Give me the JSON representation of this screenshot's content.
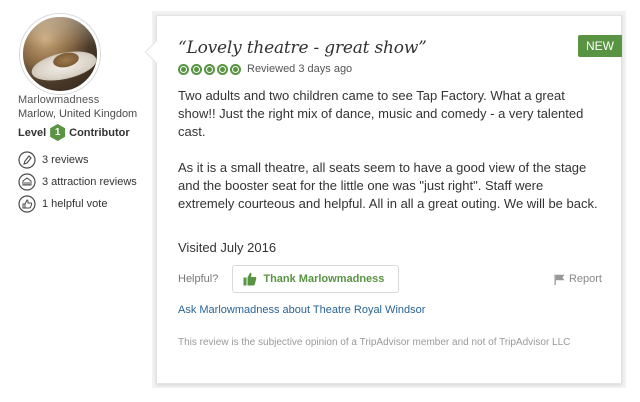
{
  "member": {
    "username": "Marlowmadness",
    "location": "Marlow, United Kingdom",
    "level_label": "Level",
    "level_number": "1",
    "level_suffix": "Contributor",
    "stats": [
      {
        "icon": "pen-icon",
        "text": "3 reviews"
      },
      {
        "icon": "attraction-icon",
        "text": "3 attraction reviews"
      },
      {
        "icon": "thumbs-up-circle-icon",
        "text": "1 helpful vote"
      }
    ]
  },
  "review": {
    "badge": "NEW",
    "title": "“Lovely theatre - great show”",
    "rating": 5,
    "rating_max": 5,
    "reviewed": "Reviewed 3 days ago",
    "paragraphs": [
      "Two adults and two children came to see Tap Factory. What a great show!! Just the right mix of dance, music and comedy - a very talented cast.",
      "As it is a small theatre, all seats seem to have a good view of the stage and the booster seat for the little one was \"just right\". Staff were extremely courteous and helpful. All in all a great outing. We will be back."
    ],
    "visited": "Visited July 2016",
    "helpful_label": "Helpful?",
    "thank_button": "Thank Marlowmadness",
    "report_label": "Report",
    "ask_link": "Ask Marlowmadness about Theatre Royal Windsor",
    "disclaimer": "This review is the subjective opinion of a TripAdvisor member and not of TripAdvisor LLC"
  },
  "colors": {
    "accent_green": "#589442",
    "link_blue": "#2a6496"
  }
}
